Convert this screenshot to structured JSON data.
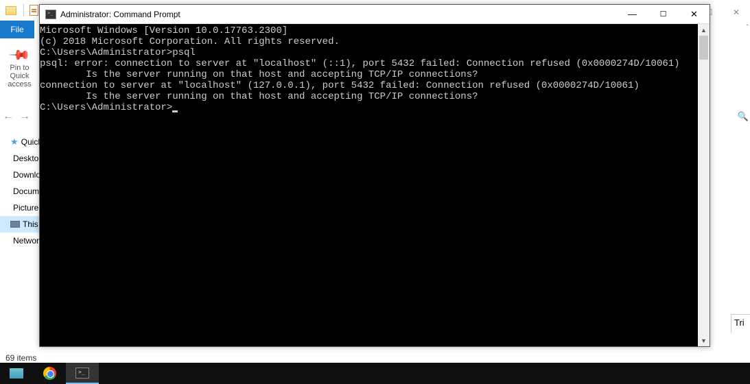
{
  "explorer": {
    "ribbon_tab": "File",
    "pin_label": "Pin to Quick access",
    "sidebar": [
      {
        "icon": "star",
        "label": "Quick"
      },
      {
        "icon": "blue",
        "label": "Desktop"
      },
      {
        "icon": "blue",
        "label": "Downloads"
      },
      {
        "icon": "blue",
        "label": "Documents"
      },
      {
        "icon": "blue",
        "label": "Pictures"
      },
      {
        "icon": "pc",
        "label": "This",
        "selected": true
      },
      {
        "icon": "blue",
        "label": "Network"
      }
    ],
    "status": "69 items",
    "trial": "Tri"
  },
  "cmd": {
    "title": "Administrator: Command Prompt",
    "lines": [
      "Microsoft Windows [Version 10.0.17763.2300]",
      "(c) 2018 Microsoft Corporation. All rights reserved.",
      "",
      "C:\\Users\\Administrator>psql",
      "psql: error: connection to server at \"localhost\" (::1), port 5432 failed: Connection refused (0x0000274D/10061)",
      "        Is the server running on that host and accepting TCP/IP connections?",
      "connection to server at \"localhost\" (127.0.0.1), port 5432 failed: Connection refused (0x0000274D/10061)",
      "        Is the server running on that host and accepting TCP/IP connections?",
      "",
      "C:\\Users\\Administrator>"
    ]
  }
}
